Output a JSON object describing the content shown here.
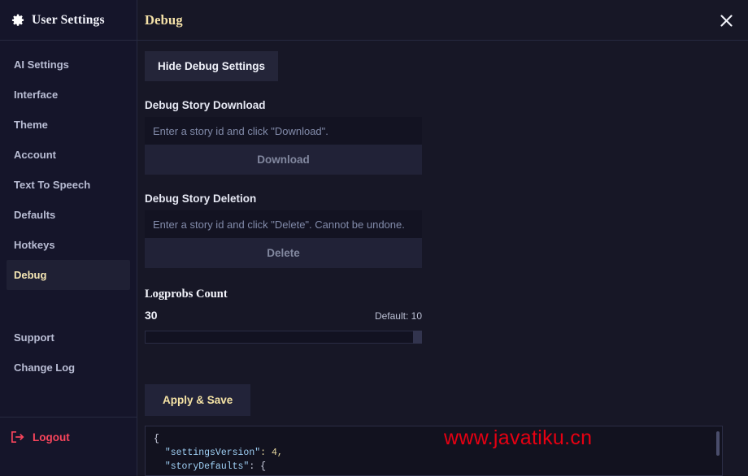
{
  "sidebar": {
    "title": "User Settings",
    "icon": "gear-icon",
    "items": [
      {
        "label": "AI Settings",
        "active": false
      },
      {
        "label": "Interface",
        "active": false
      },
      {
        "label": "Theme",
        "active": false
      },
      {
        "label": "Account",
        "active": false
      },
      {
        "label": "Text To Speech",
        "active": false
      },
      {
        "label": "Defaults",
        "active": false
      },
      {
        "label": "Hotkeys",
        "active": false
      },
      {
        "label": "Debug",
        "active": true
      }
    ],
    "secondary_items": [
      {
        "label": "Support"
      },
      {
        "label": "Change Log"
      }
    ],
    "logout": {
      "label": "Logout",
      "icon": "logout-icon",
      "color": "#f9455c"
    }
  },
  "header": {
    "title": "Debug",
    "title_color": "#f5e2a8",
    "close_icon": "close-icon"
  },
  "main": {
    "toggle_button": "Hide Debug Settings",
    "download_section": {
      "label": "Debug Story Download",
      "input_value": "",
      "input_placeholder": "Enter a story id and click \"Download\".",
      "button_label": "Download"
    },
    "deletion_section": {
      "label": "Debug Story Deletion",
      "input_value": "",
      "input_placeholder": "Enter a story id and click \"Delete\". Cannot be undone.",
      "button_label": "Delete"
    },
    "logprobs": {
      "title": "Logprobs Count",
      "value": "30",
      "default_text": "Default: 10",
      "slider_percent": 100
    },
    "save_button": "Apply & Save",
    "save_button_color": "#f5e3a5"
  },
  "code": {
    "line1": "{",
    "line2_key": "\"settingsVersion\"",
    "line2_rest": ": 4,",
    "line3_key": "\"storyDefaults\"",
    "line3_rest": ": {"
  },
  "watermark": {
    "text": "www.javatiku.cn",
    "color": "#e60012"
  }
}
